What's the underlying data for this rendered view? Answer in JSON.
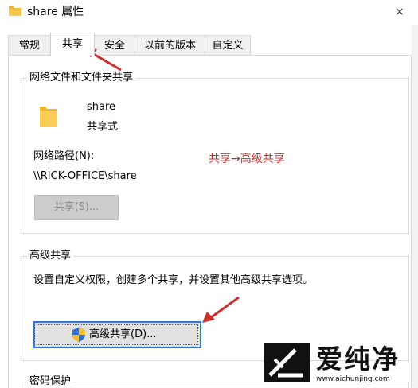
{
  "window": {
    "title": "share 属性",
    "close_icon": "×"
  },
  "tabs": [
    {
      "label": "常规",
      "active": false
    },
    {
      "label": "共享",
      "active": true
    },
    {
      "label": "安全",
      "active": false
    },
    {
      "label": "以前的版本",
      "active": false
    },
    {
      "label": "自定义",
      "active": false
    }
  ],
  "network_sharing": {
    "group_title": "网络文件和文件夹共享",
    "folder_name": "share",
    "share_state": "共享式",
    "path_label": "网络路径(N):",
    "path_value": "\\\\RICK-OFFICE\\share",
    "share_button": "共享(S)..."
  },
  "annotation": {
    "text": "共享→高级共享",
    "color": "#c9302c"
  },
  "advanced_sharing": {
    "group_title": "高级共享",
    "description": "设置自定义权限，创建多个共享，并设置其他高级共享选项。",
    "button": "高级共享(D)..."
  },
  "password_protection": {
    "group_title": "密码保护"
  },
  "watermark": {
    "brand": "爱纯净",
    "site": "www.aichunjing.com"
  },
  "colors": {
    "annotation": "#c9302c",
    "focus": "#2f78d6",
    "folder": "#f5c84c"
  }
}
